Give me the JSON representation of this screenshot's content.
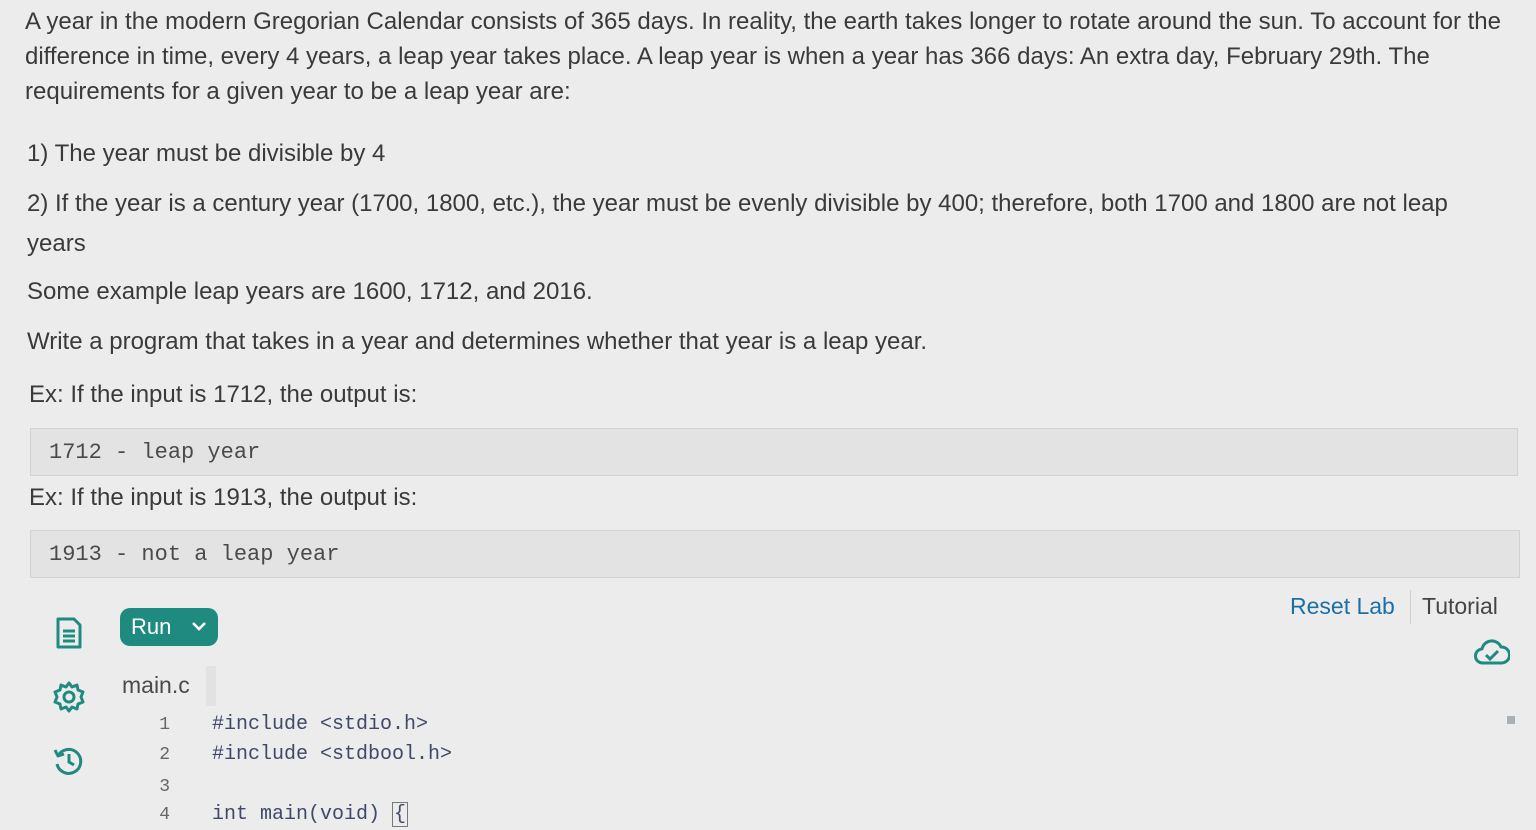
{
  "description": {
    "intro": "A year in the modern Gregorian Calendar consists of 365 days. In reality, the earth takes longer to rotate around the sun. To account for the difference in time, every 4 years, a leap year takes place. A leap year is when a year has 366 days: An extra day, February 29th. The requirements for a given year to be a leap year are:",
    "req1": "1) The year must be divisible by 4",
    "req2": "2) If the year is a century year (1700, 1800, etc.), the year must be evenly divisible by 400; therefore, both 1700 and 1800 are not leap years",
    "examples": "Some example leap years are 1600, 1712, and 2016.",
    "task": "Write a program that takes in a year and determines whether that year is a leap year.",
    "ex1_label": "Ex: If the input is 1712, the output is:",
    "ex1_output": "1712 - leap year",
    "ex2_label": "Ex: If the input is 1913, the output is:",
    "ex2_output": "1913 - not a leap year"
  },
  "toolbar": {
    "run_label": "Run",
    "reset_label": "Reset Lab",
    "tutorial_label": "Tutorial"
  },
  "sidebar": {
    "icons": [
      "file-icon",
      "settings-icon",
      "history-icon"
    ]
  },
  "editor": {
    "filename": "main.c",
    "lines": [
      {
        "num": "1",
        "code": "#include <stdio.h>"
      },
      {
        "num": "2",
        "code": "#include <stdbool.h>"
      },
      {
        "num": "3",
        "code": ""
      },
      {
        "num": "4",
        "code": "int main(void) "
      }
    ],
    "brace": "{"
  },
  "colors": {
    "accent": "#1f8a80",
    "link": "#1c6fa6",
    "background": "#ececec"
  }
}
